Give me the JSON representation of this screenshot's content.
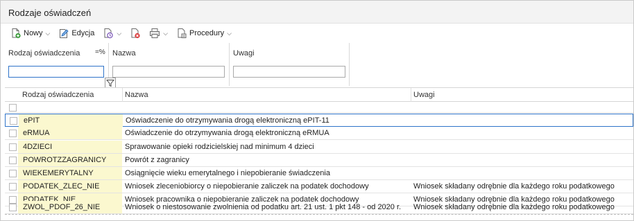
{
  "window": {
    "title": "Rodzaje oświadczeń"
  },
  "toolbar": {
    "new_label": "Nowy",
    "edit_label": "Edycja",
    "procedures_label": "Procedury"
  },
  "filters": {
    "code_label": "Rodzaj oświadczenia",
    "code_option": "=%",
    "name_label": "Nazwa",
    "notes_label": "Uwagi",
    "code_value": "",
    "name_value": "",
    "notes_value": ""
  },
  "grid": {
    "columns": [
      "Rodzaj oświadczenia",
      "Nazwa",
      "Uwagi"
    ],
    "rows": [
      {
        "code": "ePIT",
        "name": "Oświadczenie do otrzymywania drogą elektroniczną ePIT-11",
        "note": ""
      },
      {
        "code": "eRMUA",
        "name": "Oświadczenie do otrzymywania drogą elektroniczną eRMUA",
        "note": ""
      },
      {
        "code": "4DZIECI",
        "name": "Sprawowanie opieki rodzicielskiej nad minimum 4 dzieci",
        "note": ""
      },
      {
        "code": "POWROTZZAGRANICY",
        "name": "Powrót z zagranicy",
        "note": ""
      },
      {
        "code": "WIEKEMERYTALNY",
        "name": "Osiągnięcie wieku emerytalnego i niepobieranie świadczenia",
        "note": ""
      },
      {
        "code": "PODATEK_ZLEC_NIE",
        "name": "Wniosek zleceniobiorcy o niepobieranie zaliczek na podatek dochodowy",
        "note": "Wniosek składany odrębnie dla każdego roku podatkowego"
      },
      {
        "code": "PODATEK_NIE",
        "name": "Wniosek pracownika o niepobieranie zaliczek na podatek dochodowy",
        "note": "Wniosek składany odrębnie dla każdego roku podatkowego"
      },
      {
        "code": "ZWOL_PDOF_26_NIE",
        "name": "Wniosek o niestosowanie zwolnienia od podatku art. 21 ust. 1 pkt 148 - od 2020 r.",
        "note": "Wniosek składany odrębnie dla każdego roku podatkowego"
      }
    ]
  },
  "colors": {
    "accent": "#2f74c9",
    "code_cell_bg": "#fbf8cf",
    "title_bar_bg": "#f3f3f3"
  }
}
